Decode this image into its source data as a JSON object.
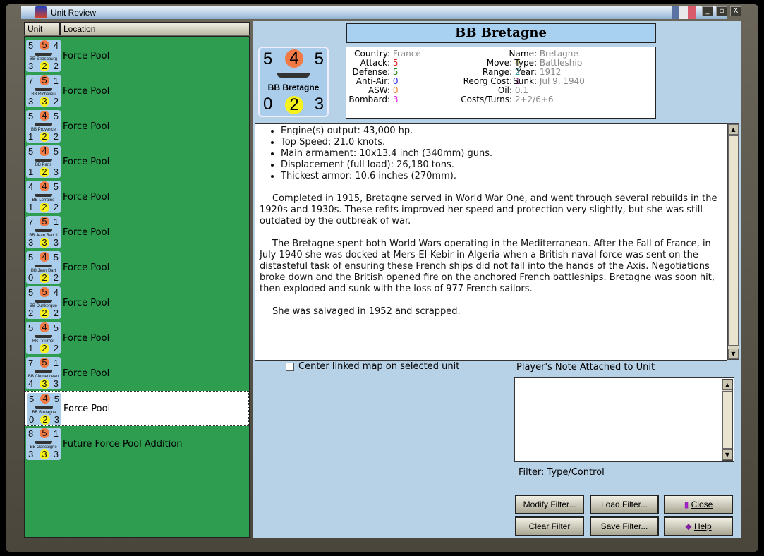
{
  "window": {
    "title": "Unit Review",
    "flag_colors": [
      "#5a73a3",
      "#e8e8e8",
      "#d95a6a"
    ]
  },
  "list": {
    "headers": [
      "Unit",
      "Location"
    ],
    "selected_index": 10,
    "units": [
      {
        "name": "BB Strasbourg",
        "stats": [
          5,
          5,
          4,
          3,
          2,
          2
        ],
        "location": "Force Pool"
      },
      {
        "name": "BB Richelieu",
        "stats": [
          7,
          5,
          1,
          3,
          3,
          2
        ],
        "location": "Force Pool"
      },
      {
        "name": "BB Provence",
        "stats": [
          5,
          4,
          5,
          1,
          2,
          2
        ],
        "location": "Force Pool"
      },
      {
        "name": "BB Paris",
        "stats": [
          5,
          4,
          5,
          1,
          2,
          3
        ],
        "location": "Force Pool"
      },
      {
        "name": "BB Lorraine",
        "stats": [
          4,
          4,
          5,
          1,
          2,
          2
        ],
        "location": "Force Pool"
      },
      {
        "name": "BB Jean Bart II",
        "stats": [
          7,
          5,
          1,
          3,
          3,
          3
        ],
        "location": "Force Pool"
      },
      {
        "name": "BB Jean Bart",
        "stats": [
          5,
          4,
          5,
          0,
          2,
          2
        ],
        "location": "Force Pool"
      },
      {
        "name": "BB Dunkerque",
        "stats": [
          5,
          5,
          4,
          2,
          2,
          2
        ],
        "location": "Force Pool"
      },
      {
        "name": "BB Courbet",
        "stats": [
          5,
          4,
          5,
          1,
          2,
          2
        ],
        "location": "Force Pool"
      },
      {
        "name": "BB Clemenceau",
        "stats": [
          7,
          5,
          1,
          4,
          3,
          3
        ],
        "location": "Force Pool"
      },
      {
        "name": "BB Bretagne",
        "stats": [
          5,
          4,
          5,
          0,
          2,
          3
        ],
        "location": "Force Pool"
      },
      {
        "name": "BB Gascoigne",
        "stats": [
          8,
          5,
          1,
          3,
          3,
          3
        ],
        "location": "Future Force Pool Addition"
      }
    ]
  },
  "unit": {
    "title": "BB Bretagne",
    "counter": {
      "name": "BB Bretagne",
      "tl": "5",
      "tc": "4",
      "tr": "5",
      "bl": "0",
      "bc": "2",
      "br": "3"
    },
    "stats": [
      {
        "k": "Country:",
        "v": "France",
        "c": "#888"
      },
      {
        "k": "Attack:",
        "v": "5",
        "c": "#e02020"
      },
      {
        "k": "Defense:",
        "v": "5",
        "c": "#208020"
      },
      {
        "k": "Anti-Air:",
        "v": "0",
        "c": "#2020e0"
      },
      {
        "k": "ASW:",
        "v": "0",
        "c": "#f08020"
      },
      {
        "k": "Bombard:",
        "v": "3",
        "c": "#e020e0"
      },
      {
        "k": "Move:",
        "v": "4",
        "c": "#a0a020"
      },
      {
        "k": "Range:",
        "v": "2",
        "c": "#20a0a0"
      },
      {
        "k": "Reorg Cost:",
        "v": "1",
        "c": "#802080"
      },
      {
        "k": "Oil:",
        "v": "0.1",
        "c": "#888"
      },
      {
        "k": "Costs/Turns:",
        "v": "2+2/6+6",
        "c": "#888"
      },
      {
        "k": "Name:",
        "v": "Bretagne",
        "c": "#888"
      },
      {
        "k": "Type:",
        "v": "Battleship",
        "c": "#888"
      },
      {
        "k": "Year:",
        "v": "1912",
        "c": "#888"
      },
      {
        "k": "Sunk:",
        "v": "Jul 9, 1940",
        "c": "#888"
      }
    ],
    "bullets": [
      "Engine(s) output: 43,000 hp.",
      "Top Speed: 21.0 knots.",
      "Main armament: 10x13.4 inch (340mm) guns.",
      "Displacement (full load): 26,180 tons.",
      "Thickest armor: 10.6 inches (270mm)."
    ],
    "paragraphs": [
      "Completed in 1915, Bretagne served in World War One, and went through several rebuilds in the 1920s and 1930s. These refits improved her speed and protection very slightly, but she was still outdated by the outbreak of war.",
      "The Bretagne spent both World Wars operating in the Mediterranean.  After the Fall of France, in July 1940 she was docked at Mers-El-Kebir in Algeria when a British naval force was sent on the distasteful task of ensuring these French ships did not fall into the hands of the Axis. Negotiations broke down and the British opened fire on the anchored French battleships. Bretagne was soon hit, then exploded and sunk with the loss of 977 French sailors.",
      "She was salvaged in 1952 and scrapped."
    ]
  },
  "options": {
    "center_map": "Center linked map on selected unit",
    "note_label": "Player's Note Attached to Unit",
    "filter": "Filter:  Type/Control"
  },
  "buttons": {
    "modify": "Modify Filter...",
    "load": "Load Filter...",
    "close": "Close",
    "clear": "Clear Filter",
    "save": "Save Filter...",
    "help": "Help"
  }
}
